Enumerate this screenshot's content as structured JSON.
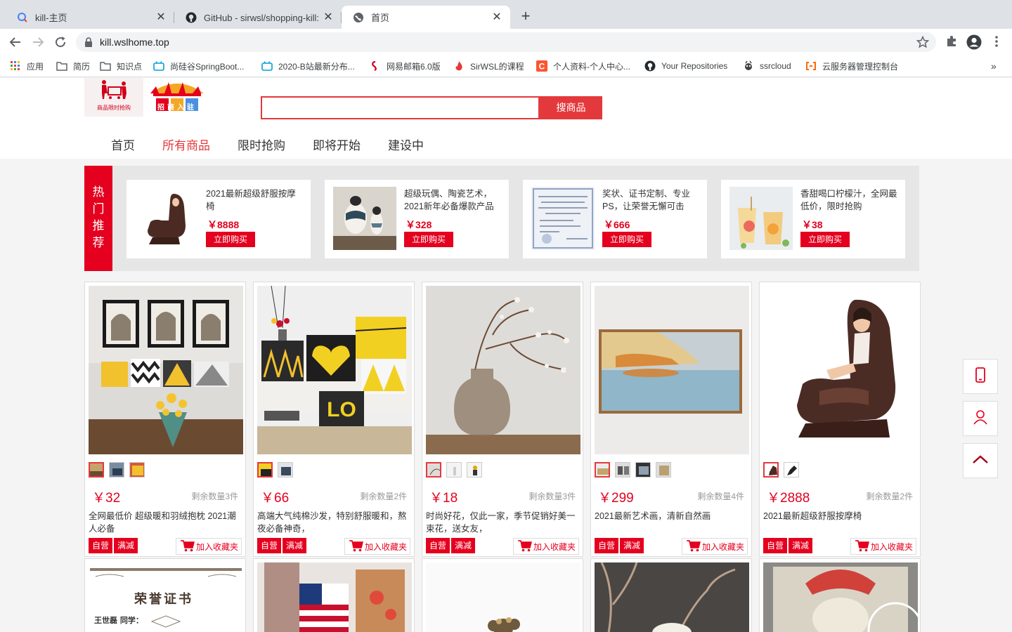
{
  "browser": {
    "tabs": [
      {
        "title": "kill-主页",
        "icon": "search-favicon"
      },
      {
        "title": "GitHub - sirwsl/shopping-kill: 基",
        "icon": "github-icon"
      },
      {
        "title": "首页",
        "icon": "globe-icon"
      }
    ],
    "url": "kill.wslhome.top",
    "bookmarks": [
      {
        "label": "应用",
        "icon": "apps-grid-icon"
      },
      {
        "label": "简历",
        "icon": "folder-icon"
      },
      {
        "label": "知识点",
        "icon": "folder-icon"
      },
      {
        "label": "尚硅谷SpringBoot...",
        "icon": "bilibili-icon"
      },
      {
        "label": "2020-B站最新分布...",
        "icon": "bilibili-icon"
      },
      {
        "label": "网易邮箱6.0版",
        "icon": "netease-mail-icon"
      },
      {
        "label": "SirWSL的课程",
        "icon": "flame-icon"
      },
      {
        "label": "个人资料-个人中心...",
        "icon": "csdn-icon"
      },
      {
        "label": "Your Repositories",
        "icon": "github-icon"
      },
      {
        "label": "ssrcloud",
        "icon": "ssrcloud-icon"
      },
      {
        "label": "云服务器管理控制台",
        "icon": "aliyun-icon"
      }
    ]
  },
  "header": {
    "logo_text": "商品限时抢购",
    "logo2_text": "招商入驻",
    "search_button": "搜商品",
    "nav": [
      "首页",
      "所有商品",
      "限时抢购",
      "即将开始",
      "建设中"
    ]
  },
  "hot": {
    "label": [
      "热",
      "门",
      "推",
      "荐"
    ],
    "buy_label": "立即购买",
    "items": [
      {
        "name": "2021最新超级舒服按摩椅",
        "price": "￥8888"
      },
      {
        "name": "超级玩偶、陶瓷艺术，2021新年必备爆款产品",
        "price": "￥328"
      },
      {
        "name": "奖状、证书定制、专业PS，让荣誉无懈可击",
        "price": "￥666"
      },
      {
        "name": "香甜喝口柠檬汁，全网最低价，限时抢购",
        "price": "￥38"
      }
    ]
  },
  "products": {
    "tag_self": "自营",
    "tag_discount": "满减",
    "fav_label": "加入收藏夹",
    "items": [
      {
        "price": "￥32",
        "stock": "剩余数量3件",
        "desc": "全网最低价 超级暖和羽绒抱枕 2021潮人必备",
        "thumbs": 3
      },
      {
        "price": "￥66",
        "stock": "剩余数量2件",
        "desc": "高端大气纯棉沙发，特别舒服暖和，熬夜必备神奇，",
        "thumbs": 2
      },
      {
        "price": "￥18",
        "stock": "剩余数量3件",
        "desc": "时尚好花，仅此一家，季节促销好美一束花，送女友，",
        "thumbs": 3
      },
      {
        "price": "￥299",
        "stock": "剩余数量4件",
        "desc": "2021最新艺术画，清新自然画",
        "thumbs": 4
      },
      {
        "price": "￥2888",
        "stock": "剩余数量2件",
        "desc": "2021最新超级舒服按摩椅",
        "thumbs": 2
      }
    ],
    "second_row": {
      "certificate_title": "荣誉证书",
      "certificate_line": "王世磊 同学："
    }
  },
  "side_icons": [
    "phone-icon",
    "user-icon",
    "back-to-top-icon"
  ],
  "colors": {
    "accent": "#e4001e",
    "search_border": "#e4393c"
  }
}
